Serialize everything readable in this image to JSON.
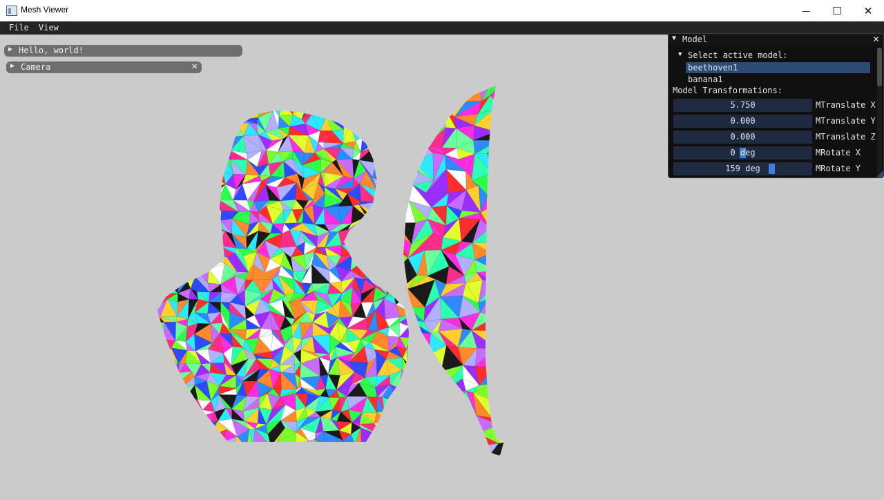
{
  "window": {
    "title": "Mesh Viewer",
    "minimize_glyph": "—",
    "maximize_glyph": "☐",
    "close_glyph": "✕"
  },
  "menubar": {
    "items": [
      "File",
      "View"
    ]
  },
  "collapsed_windows": [
    {
      "label": "Hello, world!",
      "arrow": "▶"
    },
    {
      "label": "Camera",
      "arrow": "▶",
      "close": "✕"
    }
  ],
  "model_panel": {
    "title": "Model",
    "arrow": "▼",
    "close": "✕",
    "tree_arrow": "▼",
    "select_label": "Select active model:",
    "models": [
      "beethoven1",
      "banana1"
    ],
    "selected_model": "beethoven1",
    "section_label": "Model Transformations:",
    "controls": [
      {
        "value": "5.750",
        "label": "MTranslate X"
      },
      {
        "value": "0.000",
        "label": "MTranslate Y"
      },
      {
        "value": "0.000",
        "label": "MTranslate Z"
      },
      {
        "value": "0 deg",
        "label": "MRotate X"
      },
      {
        "value": "159 deg",
        "label": "MRotate Y"
      }
    ]
  },
  "viewport": {
    "models": [
      "beethoven-bust",
      "banana"
    ],
    "background": "#cbcbcb"
  }
}
